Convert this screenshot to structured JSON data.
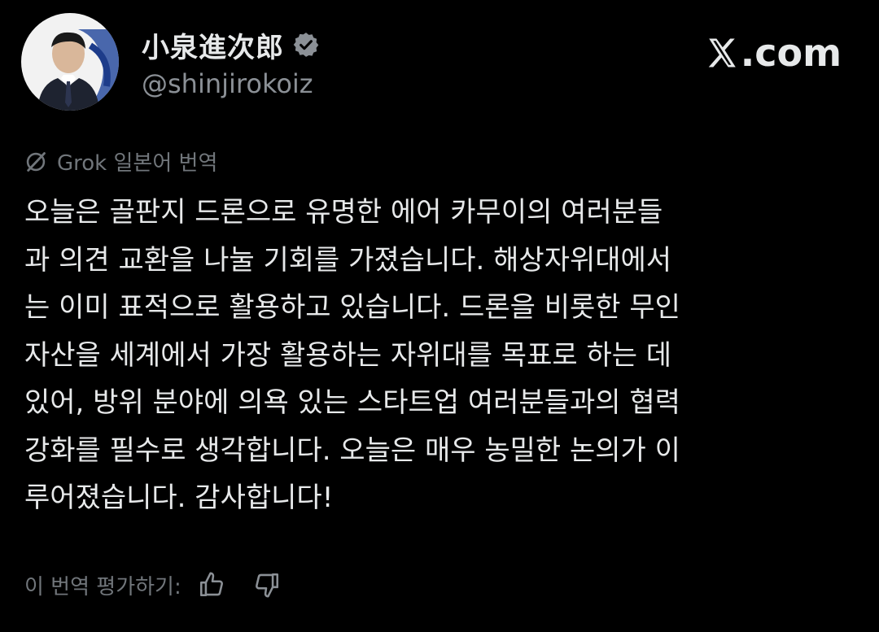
{
  "header": {
    "display_name": "小泉進次郎",
    "handle": "@shinjirokoiz",
    "verified": true,
    "brand_text": ".com",
    "brand_icon": "x-logo-icon",
    "avatar_icon": "profile-photo"
  },
  "translation": {
    "icon": "grok-icon",
    "label": "Grok 일본어 번역"
  },
  "tweet": {
    "lines": [
      "오늘은 골판지 드론으로 유명한 에어 카무이의 여러분들",
      "과 의견 교환을 나눌 기회를 가졌습니다. 해상자위대에서",
      "는 이미 표적으로 활용하고 있습니다. 드론을 비롯한 무인",
      "자산을 세계에서 가장 활용하는 자위대를 목표로 하는 데",
      "있어, 방위 분야에 의욕 있는 스타트업 여러분들과의 협력",
      "강화를 필수로 생각합니다. 오늘은 매우 농밀한 논의가 이",
      "루어졌습니다. 감사합니다!"
    ]
  },
  "rating": {
    "label": "이 번역 평가하기:",
    "thumbs_up_icon": "thumbs-up-icon",
    "thumbs_down_icon": "thumbs-down-icon"
  },
  "colors": {
    "background": "#000000",
    "text_primary": "#e7e9ea",
    "text_secondary": "#71767b",
    "verified_badge": "#8b9096"
  }
}
